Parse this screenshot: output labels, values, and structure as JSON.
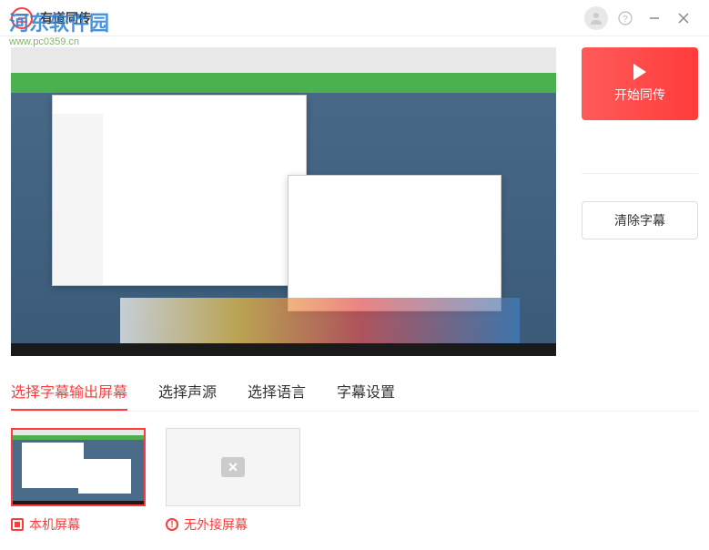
{
  "app": {
    "title": "有道同传"
  },
  "watermark": {
    "title": "河东软件园",
    "url": "www.pc0359.cn"
  },
  "actions": {
    "start_label": "开始同传",
    "clear_label": "清除字幕"
  },
  "tabs": [
    {
      "label": "选择字幕输出屏幕",
      "active": true
    },
    {
      "label": "选择声源",
      "active": false
    },
    {
      "label": "选择语言",
      "active": false
    },
    {
      "label": "字幕设置",
      "active": false
    }
  ],
  "screens": {
    "local": {
      "label": "本机屏幕",
      "selected": true
    },
    "external": {
      "label": "无外接屏幕",
      "available": false
    }
  },
  "colors": {
    "accent": "#ff3b3b",
    "text": "#333333",
    "muted": "#999999"
  }
}
